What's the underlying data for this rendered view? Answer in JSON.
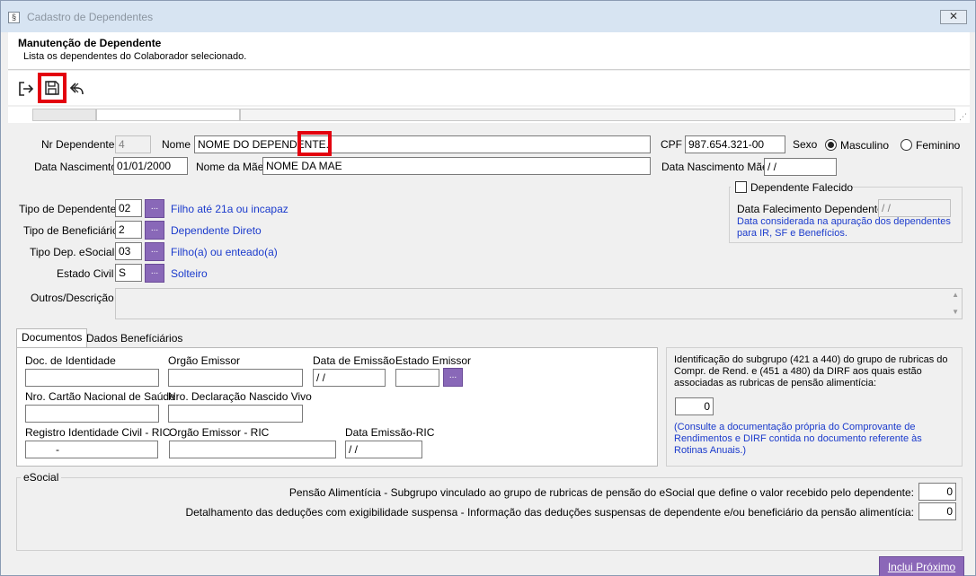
{
  "window": {
    "title": "Cadastro de Dependentes",
    "close_glyph": "✕"
  },
  "header": {
    "title": "Manutenção de Dependente",
    "subtitle": "Lista os dependentes do Colaborador selecionado."
  },
  "form": {
    "nr_dependente": {
      "label": "Nr Dependente",
      "value": "4"
    },
    "nome": {
      "label": "Nome",
      "value": "NOME DO DEPENDENTE."
    },
    "cpf": {
      "label": "CPF",
      "value": "987.654.321-00"
    },
    "sexo": {
      "label": "Sexo",
      "options": [
        "Masculino",
        "Feminino"
      ],
      "selected": "Masculino"
    },
    "data_nascimento": {
      "label": "Data Nascimento",
      "value": "01/01/2000"
    },
    "nome_mae": {
      "label": "Nome da Mãe",
      "value": "NOME DA MAE"
    },
    "data_nasc_mae": {
      "label": "Data Nascimento Mãe",
      "value": " / /"
    },
    "tipo_dependente": {
      "label": "Tipo de Dependente",
      "value": "02",
      "desc": "Filho até 21a ou incapaz"
    },
    "tipo_beneficiario": {
      "label": "Tipo de Beneficiário",
      "value": "2",
      "desc": "Dependente Direto"
    },
    "tipo_esocial": {
      "label": "Tipo  Dep. eSocial",
      "value": "03",
      "desc": "Filho(a) ou enteado(a)"
    },
    "estado_civil": {
      "label": "Estado Civil",
      "value": "S",
      "desc": "Solteiro"
    },
    "outros": {
      "label": "Outros/Descrição"
    },
    "falecido": {
      "check_label": "Dependente Falecido",
      "date_label": "Data Falecimento Dependente",
      "date_value": " / /",
      "note": "Data considerada na apuração dos dependentes para IR, SF e Benefícios."
    },
    "lookup_glyph": "..."
  },
  "tabs": [
    {
      "label": "Documentos",
      "active": true
    },
    {
      "label": "Dados Benefíciários",
      "active": false
    }
  ],
  "documentos": {
    "doc_identidade": "Doc. de Identidade",
    "orgao_emissor": "Orgão Emissor",
    "data_emissao": {
      "label": "Data de Emissão",
      "value": " / /"
    },
    "estado_emissor": "Estado Emissor",
    "cartao_saude": "Nro. Cartão Nacional de Saúde",
    "declaracao_nascido": "Nro. Declaração Nascido Vivo",
    "ric": {
      "label": "Registro Identidade Civil - RIC",
      "value": "-"
    },
    "orgao_ric": "Orgão Emissor - RIC",
    "data_ric": {
      "label": "Data Emissão-RIC",
      "value": " / /"
    }
  },
  "dirf": {
    "text": "Identificação do subgrupo (421 a 440) do grupo de rubricas do Compr. de Rend. e (451 a 480) da DIRF aos quais estão associadas as rubricas de pensão alimentícia:",
    "value": "0",
    "note": "(Consulte a documentação própria do Comprovante de Rendimentos e DIRF contida no documento referente às Rotinas Anuais.)"
  },
  "esocial": {
    "title": "eSocial",
    "pensao_label": "Pensão Alimentícia - Subgrupo vinculado ao grupo de rubricas de pensão do eSocial que define o valor recebido pelo dependente:",
    "pensao_value": "0",
    "deducoes_label": "Detalhamento das deduções com exigibilidade suspensa - Informação das deduções suspensas de dependente e/ou beneficiário da pensão alimentícia:",
    "deducoes_value": "0"
  },
  "footer": {
    "inclui_proximo": "Inclui Próximo"
  },
  "colors": {
    "accent": "#8b67b8",
    "link_blue": "#1a3acc",
    "highlight": "#e3000f"
  }
}
